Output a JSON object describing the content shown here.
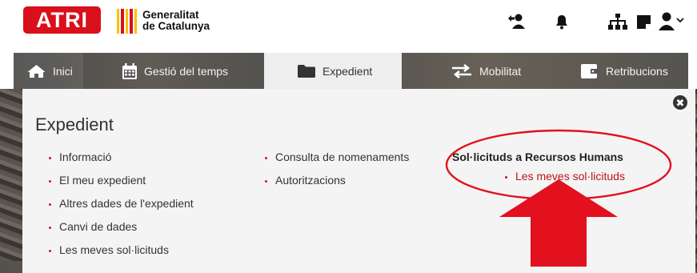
{
  "header": {
    "logo": "ATRI",
    "institution_line1": "Generalitat",
    "institution_line2": "de Catalunya",
    "icons": [
      "user-switch-icon",
      "bell-icon",
      "org-chart-icon",
      "sticky-note-icon",
      "user-menu-icon"
    ]
  },
  "nav": {
    "tabs": [
      {
        "label": "Inici",
        "icon": "home-icon"
      },
      {
        "label": "Gestió del temps",
        "icon": "calendar-icon"
      },
      {
        "label": "Expedient",
        "icon": "folder-icon",
        "active": true
      },
      {
        "label": "Mobilitat",
        "icon": "exchange-arrows-icon"
      },
      {
        "label": "Retribucions",
        "icon": "wallet-icon"
      }
    ]
  },
  "panel": {
    "title": "Expedient",
    "close": "✖",
    "column1": [
      "Informació",
      "El meu expedient",
      "Altres dades de l'expedient",
      "Canvi de dades",
      "Les meves sol·licituds"
    ],
    "column2": [
      "Consulta de nomenaments",
      "Autoritzacions"
    ],
    "rh_heading": "Sol·licituds a Recursos Humans",
    "rh_link": "Les meves sol·licituds"
  },
  "colors": {
    "brand_red": "#d9101c",
    "link_red": "#c0121c",
    "annotation_red": "#e3101d",
    "panel_bg": "#f4f4f4"
  }
}
